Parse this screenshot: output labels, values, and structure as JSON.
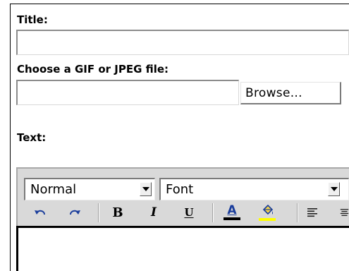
{
  "form": {
    "title_label": "Title:",
    "title_value": "",
    "file_label": "Choose a GIF or JPEG file:",
    "file_value": "",
    "browse_label": "Browse...",
    "text_label": "Text:"
  },
  "editor": {
    "format_select": {
      "selected": "Normal"
    },
    "font_select": {
      "selected": "Font"
    },
    "toolbar": [
      {
        "name": "undo-icon"
      },
      {
        "name": "redo-icon"
      },
      {
        "name": "bold-icon",
        "glyph": "B"
      },
      {
        "name": "italic-icon",
        "glyph": "I"
      },
      {
        "name": "underline-icon",
        "glyph": "U"
      },
      {
        "name": "text-color-icon",
        "glyph": "A",
        "color": "#000000"
      },
      {
        "name": "highlight-color-icon",
        "color": "#ffff00"
      },
      {
        "name": "align-left-icon"
      }
    ],
    "content": ""
  }
}
